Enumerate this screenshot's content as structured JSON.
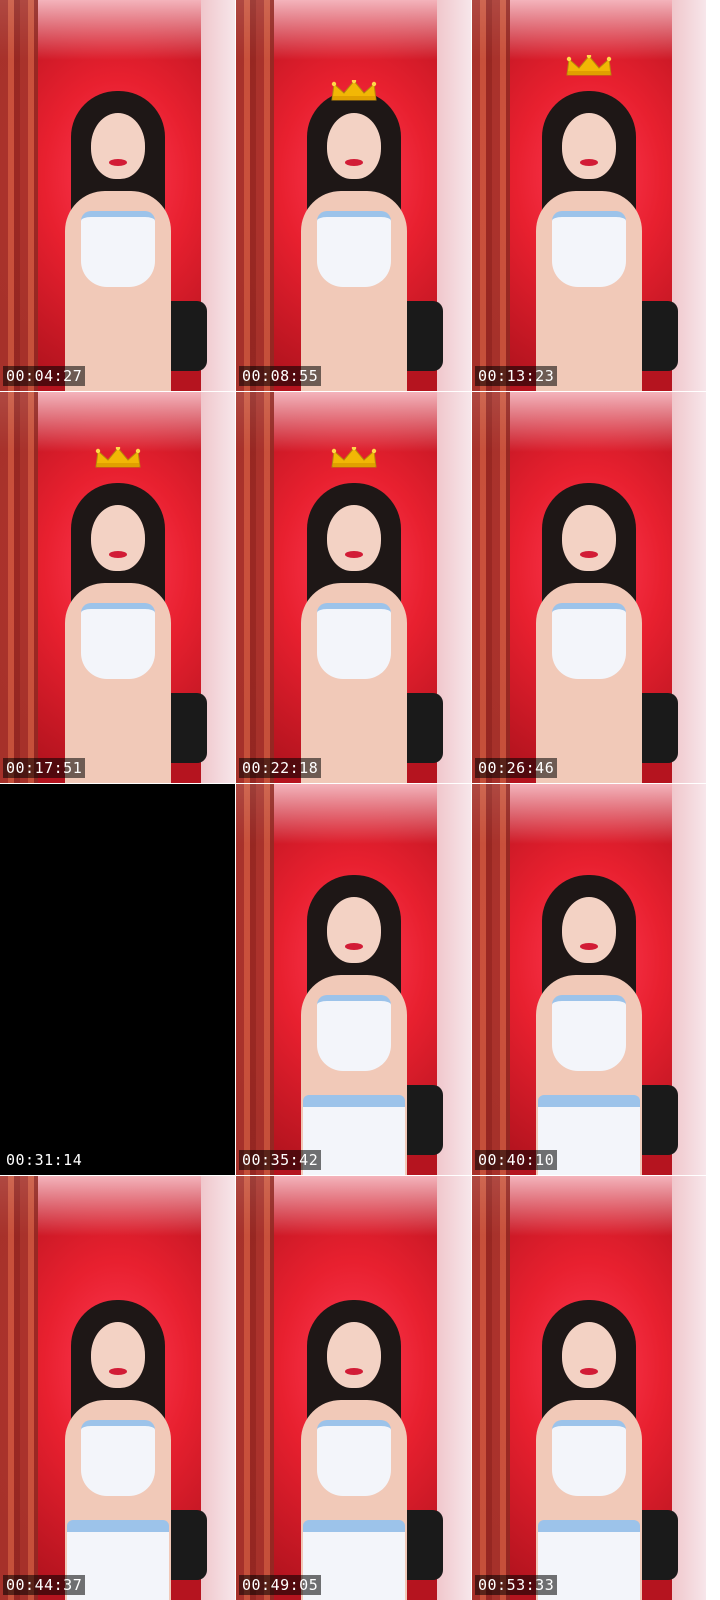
{
  "thumbnails": [
    {
      "timestamp": "00:04:27",
      "crown": false,
      "dark": false,
      "outfit": "sitting"
    },
    {
      "timestamp": "00:08:55",
      "crown": true,
      "dark": false,
      "outfit": "sitting"
    },
    {
      "timestamp": "00:13:23",
      "crown": true,
      "dark": false,
      "outfit": "sitting"
    },
    {
      "timestamp": "00:17:51",
      "crown": true,
      "dark": false,
      "outfit": "sitting"
    },
    {
      "timestamp": "00:22:18",
      "crown": true,
      "dark": false,
      "outfit": "sitting"
    },
    {
      "timestamp": "00:26:46",
      "crown": false,
      "dark": false,
      "outfit": "sitting"
    },
    {
      "timestamp": "00:31:14",
      "crown": false,
      "dark": true,
      "outfit": "none"
    },
    {
      "timestamp": "00:35:42",
      "crown": false,
      "dark": false,
      "outfit": "standing"
    },
    {
      "timestamp": "00:40:10",
      "crown": false,
      "dark": false,
      "outfit": "standing"
    },
    {
      "timestamp": "00:44:37",
      "crown": false,
      "dark": false,
      "outfit": "standing"
    },
    {
      "timestamp": "00:49:05",
      "crown": false,
      "dark": false,
      "outfit": "standing"
    },
    {
      "timestamp": "00:53:33",
      "crown": false,
      "dark": false,
      "outfit": "standing"
    }
  ],
  "colors": {
    "background": "#ffffff",
    "backdrop_red": "#e8202f",
    "top_white": "#f3f5fa",
    "trim_blue": "#9cc3ea",
    "crown_gold": "#f2b705",
    "timestamp_bg": "rgba(0,0,0,0.55)",
    "timestamp_text": "#ffffff"
  },
  "icons": {
    "crown": "crown-icon"
  }
}
